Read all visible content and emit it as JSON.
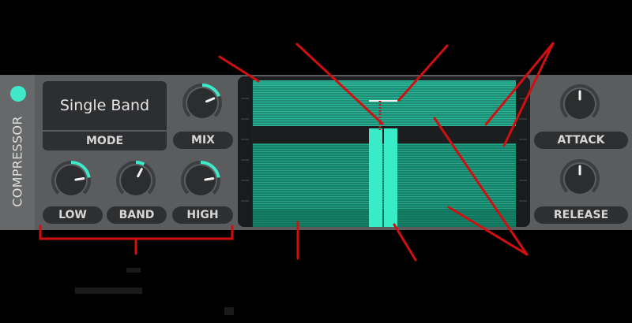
{
  "module": {
    "title": "COMPRESSOR",
    "power_on": true
  },
  "mode": {
    "value": "Single Band",
    "label": "MODE"
  },
  "knobs": {
    "mix": {
      "label": "MIX",
      "level": 0.75
    },
    "low": {
      "label": "LOW",
      "level": 0.8
    },
    "band": {
      "label": "BAND",
      "level": 0.6
    },
    "high": {
      "label": "HIGH",
      "level": 0.8
    },
    "attack": {
      "label": "ATTACK",
      "level": 0.5
    },
    "release": {
      "label": "RELEASE",
      "level": 0.5
    }
  },
  "colors": {
    "accent": "#3ee8c8",
    "panel": "#5b5c5d",
    "meter_fill": "#1f8f77",
    "annotation": "#d01010"
  }
}
